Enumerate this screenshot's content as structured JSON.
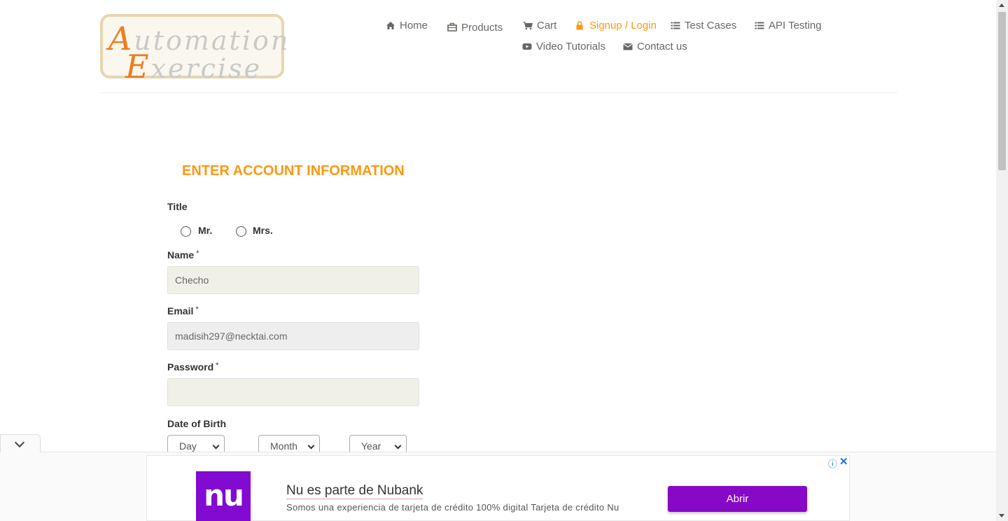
{
  "logo": {
    "line1_cap": "A",
    "line1_rest": "utomation",
    "line2_cap": "E",
    "line2_rest": "xercise"
  },
  "nav": {
    "items": [
      {
        "label": "Home",
        "icon": "home-icon"
      },
      {
        "label": "Products",
        "icon": "briefcase-icon"
      },
      {
        "label": "Cart",
        "icon": "cart-icon"
      },
      {
        "label": "Signup / Login",
        "icon": "lock-icon",
        "active": true
      },
      {
        "label": "Test Cases",
        "icon": "list-icon"
      },
      {
        "label": "API Testing",
        "icon": "list-icon"
      },
      {
        "label": "Video Tutorials",
        "icon": "youtube-play-icon"
      },
      {
        "label": "Contact us",
        "icon": "envelope-icon"
      }
    ]
  },
  "form": {
    "title": "ENTER ACCOUNT INFORMATION",
    "title_label": "Title",
    "title_options": [
      "Mr.",
      "Mrs."
    ],
    "name_label": "Name",
    "name_value": "Checho",
    "email_label": "Email",
    "email_value": "madisih297@necktai.com",
    "password_label": "Password",
    "password_value": "",
    "required_mark": "*",
    "dob_label": "Date of Birth",
    "dob_day": "Day",
    "dob_month": "Month",
    "dob_year": "Year"
  },
  "ad": {
    "logo_text": "nu",
    "headline": "Nu es parte de Nubank",
    "description": "Somos una experiencia de tarjeta de crédito 100% digital Tarjeta de crédito Nu",
    "cta": "Abrir",
    "info_glyph": "ⓘ",
    "close_glyph": "✕"
  },
  "colors": {
    "accent": "#fe980f",
    "nav_text": "#696763",
    "input_bg": "#f0f0e9",
    "ad_purple": "#820ad1",
    "ad_button": "#8708c7"
  }
}
